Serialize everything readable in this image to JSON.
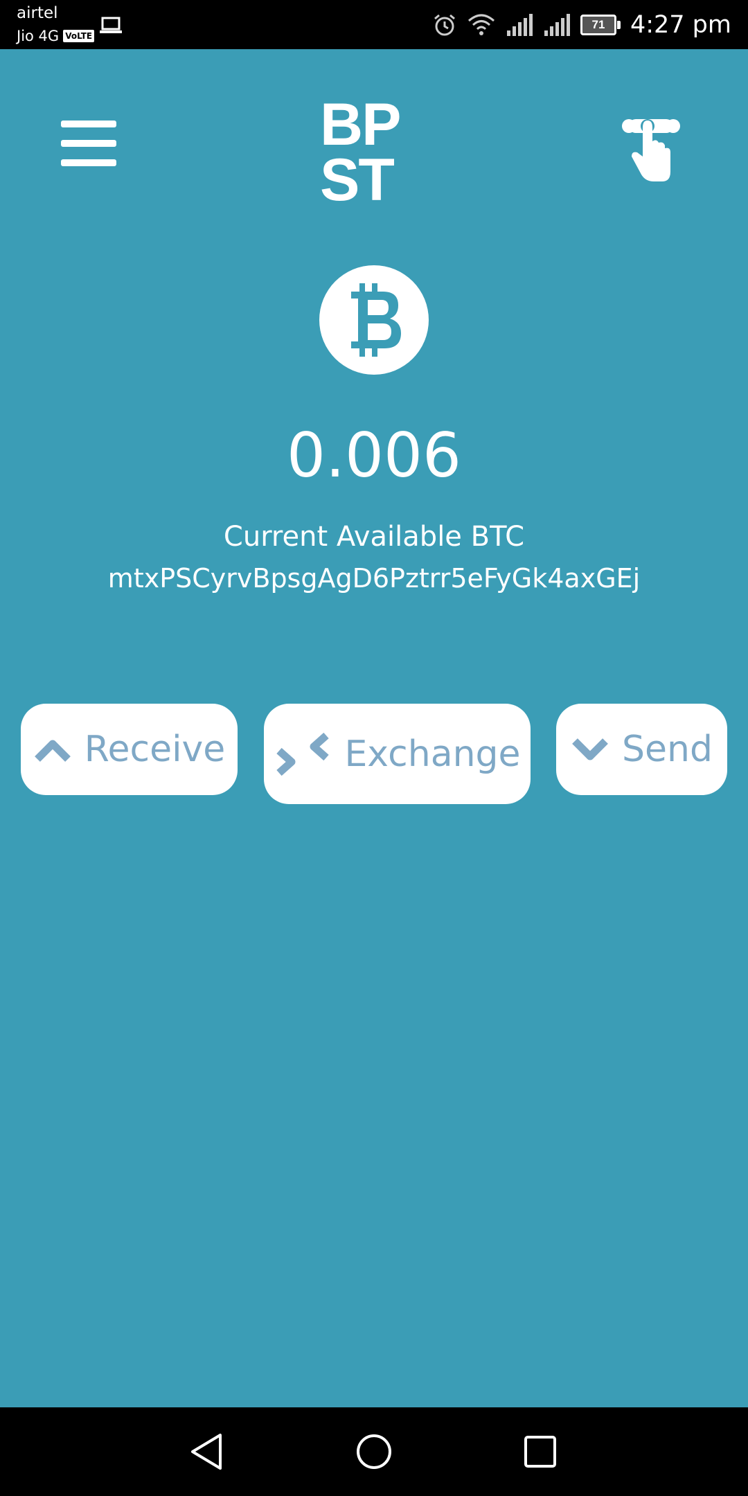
{
  "status_bar": {
    "carrier_primary": "airtel",
    "carrier_secondary": "Jio 4G",
    "volte_badge": "VoLTE",
    "battery_level": "71",
    "time": "4:27 pm"
  },
  "header": {
    "logo_line1": "BP",
    "logo_line2": "ST"
  },
  "wallet": {
    "balance": "0.006",
    "balance_label": "Current Available BTC",
    "address": "mtxPSCyrvBpsgAgD6Pztrr5eFyGk4axGEj"
  },
  "actions": {
    "receive_label": "Receive",
    "exchange_label": "Exchange",
    "send_label": "Send"
  },
  "colors": {
    "background": "#3b9db6",
    "button_text": "#7fa8c6",
    "button_bg": "#ffffff"
  },
  "icons": {
    "menu": "hamburger-menu-icon",
    "fingerprint": "fingerprint-touch-icon",
    "coin": "bitcoin-icon",
    "receive": "chevron-up-icon",
    "exchange": "exchange-arrows-icon",
    "send": "chevron-down-icon"
  }
}
